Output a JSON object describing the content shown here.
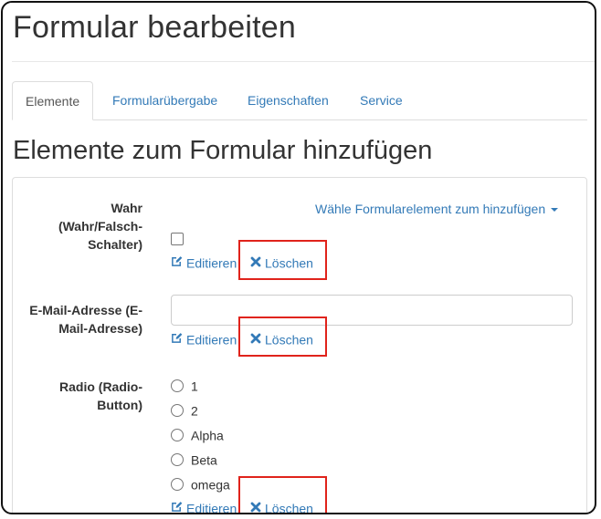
{
  "page": {
    "title": "Formular bearbeiten"
  },
  "tabs": [
    {
      "label": "Elemente",
      "active": true
    },
    {
      "label": "Formularübergabe",
      "active": false
    },
    {
      "label": "Eigenschaften",
      "active": false
    },
    {
      "label": "Service",
      "active": false
    }
  ],
  "section": {
    "title": "Elemente zum Formular hinzufügen"
  },
  "add_dropdown": {
    "label": "Wähle Formularelement zum hinzufügen"
  },
  "actions": {
    "edit_label": "Editieren",
    "delete_label": "Löschen"
  },
  "elements": [
    {
      "label_lines": [
        "Wahr",
        "(Wahr/Falsch-",
        "Schalter)"
      ],
      "type": "checkbox",
      "checked": false
    },
    {
      "label_lines": [
        "E-Mail-Adresse (E-",
        "Mail-Adresse)"
      ],
      "type": "email",
      "value": ""
    },
    {
      "label_lines": [
        "Radio (Radio-",
        "Button)"
      ],
      "type": "radio",
      "options": [
        "1",
        "2",
        "Alpha",
        "Beta",
        "omega"
      ]
    }
  ],
  "colors": {
    "link": "#337ab7",
    "highlight": "#e0231b",
    "text": "#333333"
  },
  "icons": {
    "edit": "edit-icon",
    "delete": "delete-x-icon",
    "caret": "caret-down-icon"
  }
}
